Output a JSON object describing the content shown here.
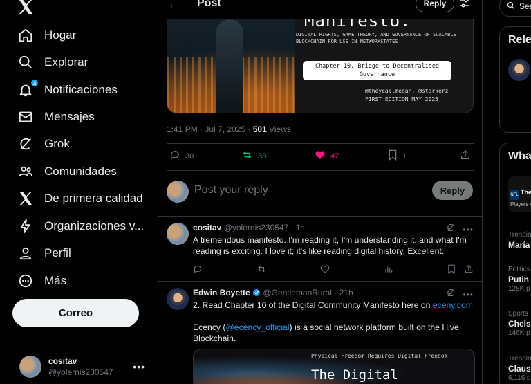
{
  "nav": {
    "items": [
      {
        "label": "Hogar",
        "icon": "home-icon"
      },
      {
        "label": "Explorar",
        "icon": "search-icon"
      },
      {
        "label": "Notificaciones",
        "icon": "bell-icon",
        "badge": "4"
      },
      {
        "label": "Mensajes",
        "icon": "mail-icon"
      },
      {
        "label": "Grok",
        "icon": "grok-icon"
      },
      {
        "label": "Comunidades",
        "icon": "people-icon"
      },
      {
        "label": "De primera calidad",
        "icon": "x-logo-icon"
      },
      {
        "label": "Organizaciones v...",
        "icon": "lightning-icon"
      },
      {
        "label": "Perfil",
        "icon": "person-icon"
      },
      {
        "label": "Más",
        "icon": "more-circle-icon"
      }
    ],
    "post_button": "Correo",
    "account": {
      "name": "cositav",
      "handle": "@yolernis230547"
    }
  },
  "header": {
    "title": "Post",
    "reply_label": "Reply"
  },
  "hero_image": {
    "title": "Manifesto.",
    "subtitle": "DIGITAL RIGHTS, GAME THEORY, AND GOVERNANCE OF SCALABLE\nBLOCKCHAIN FOR USE IN NETWORKSTATES",
    "chapter_line1": "Chapter 10. Bridge to Decentralised",
    "chapter_line2": "Governance",
    "authors": "@theycallmedan, @starkerz\nFIRST EDITION MAY 2025"
  },
  "post_meta": {
    "time": "1:41 PM · Jul 7, 2025 · ",
    "views_count": "501",
    "views_label": " Views"
  },
  "post_actions": {
    "replies": "30",
    "reposts": "33",
    "likes": "47",
    "bookmarks": "1"
  },
  "composer": {
    "placeholder": "Post your reply",
    "button": "Reply"
  },
  "replies": [
    {
      "name": "cositav",
      "handle": "@yolernis230547 · 1s",
      "text": "A tremendous manifesto. I'm reading it, I'm understanding it, and what I'm reading is exciting. I love it; it's like reading digital history. Excellent."
    },
    {
      "name": "Edwin Boyette",
      "handle": "@GentlemanRural · 21h",
      "text_prefix": "2.  Read Chapter 10 of the Digital Community Manifesto here on ",
      "link1": "eceny.com",
      "text_mid1": "Ecency (",
      "link2": "@ecency_official",
      "text_mid2": ")  is a social network platform built on the Hive Blockchain.",
      "card_line1": "Physical Freedom Requires Digital Freedom",
      "card_line2": "The Digital"
    }
  ],
  "right": {
    "search_placeholder": "Sea",
    "panel1_title": "Rele",
    "panel2_title": "Wha",
    "trends": [
      {
        "category": "Trendin",
        "topic": "María",
        "posts": ""
      },
      {
        "category": "Politics",
        "topic": "Putin",
        "posts": "128K p"
      },
      {
        "category": "Sports",
        "topic": "Chelse",
        "posts": "146K p"
      },
      {
        "category": "Trendin",
        "topic": "Claus",
        "posts": "6,116 p"
      }
    ],
    "nfl_badge": "NFL",
    "nfl_text1": "The",
    "nfl_text2": "Players c"
  },
  "colors": {
    "accent": "#1d9bf0",
    "like": "#f91880",
    "repost": "#00ba7c",
    "border": "#2f3336",
    "muted": "#71767b"
  }
}
